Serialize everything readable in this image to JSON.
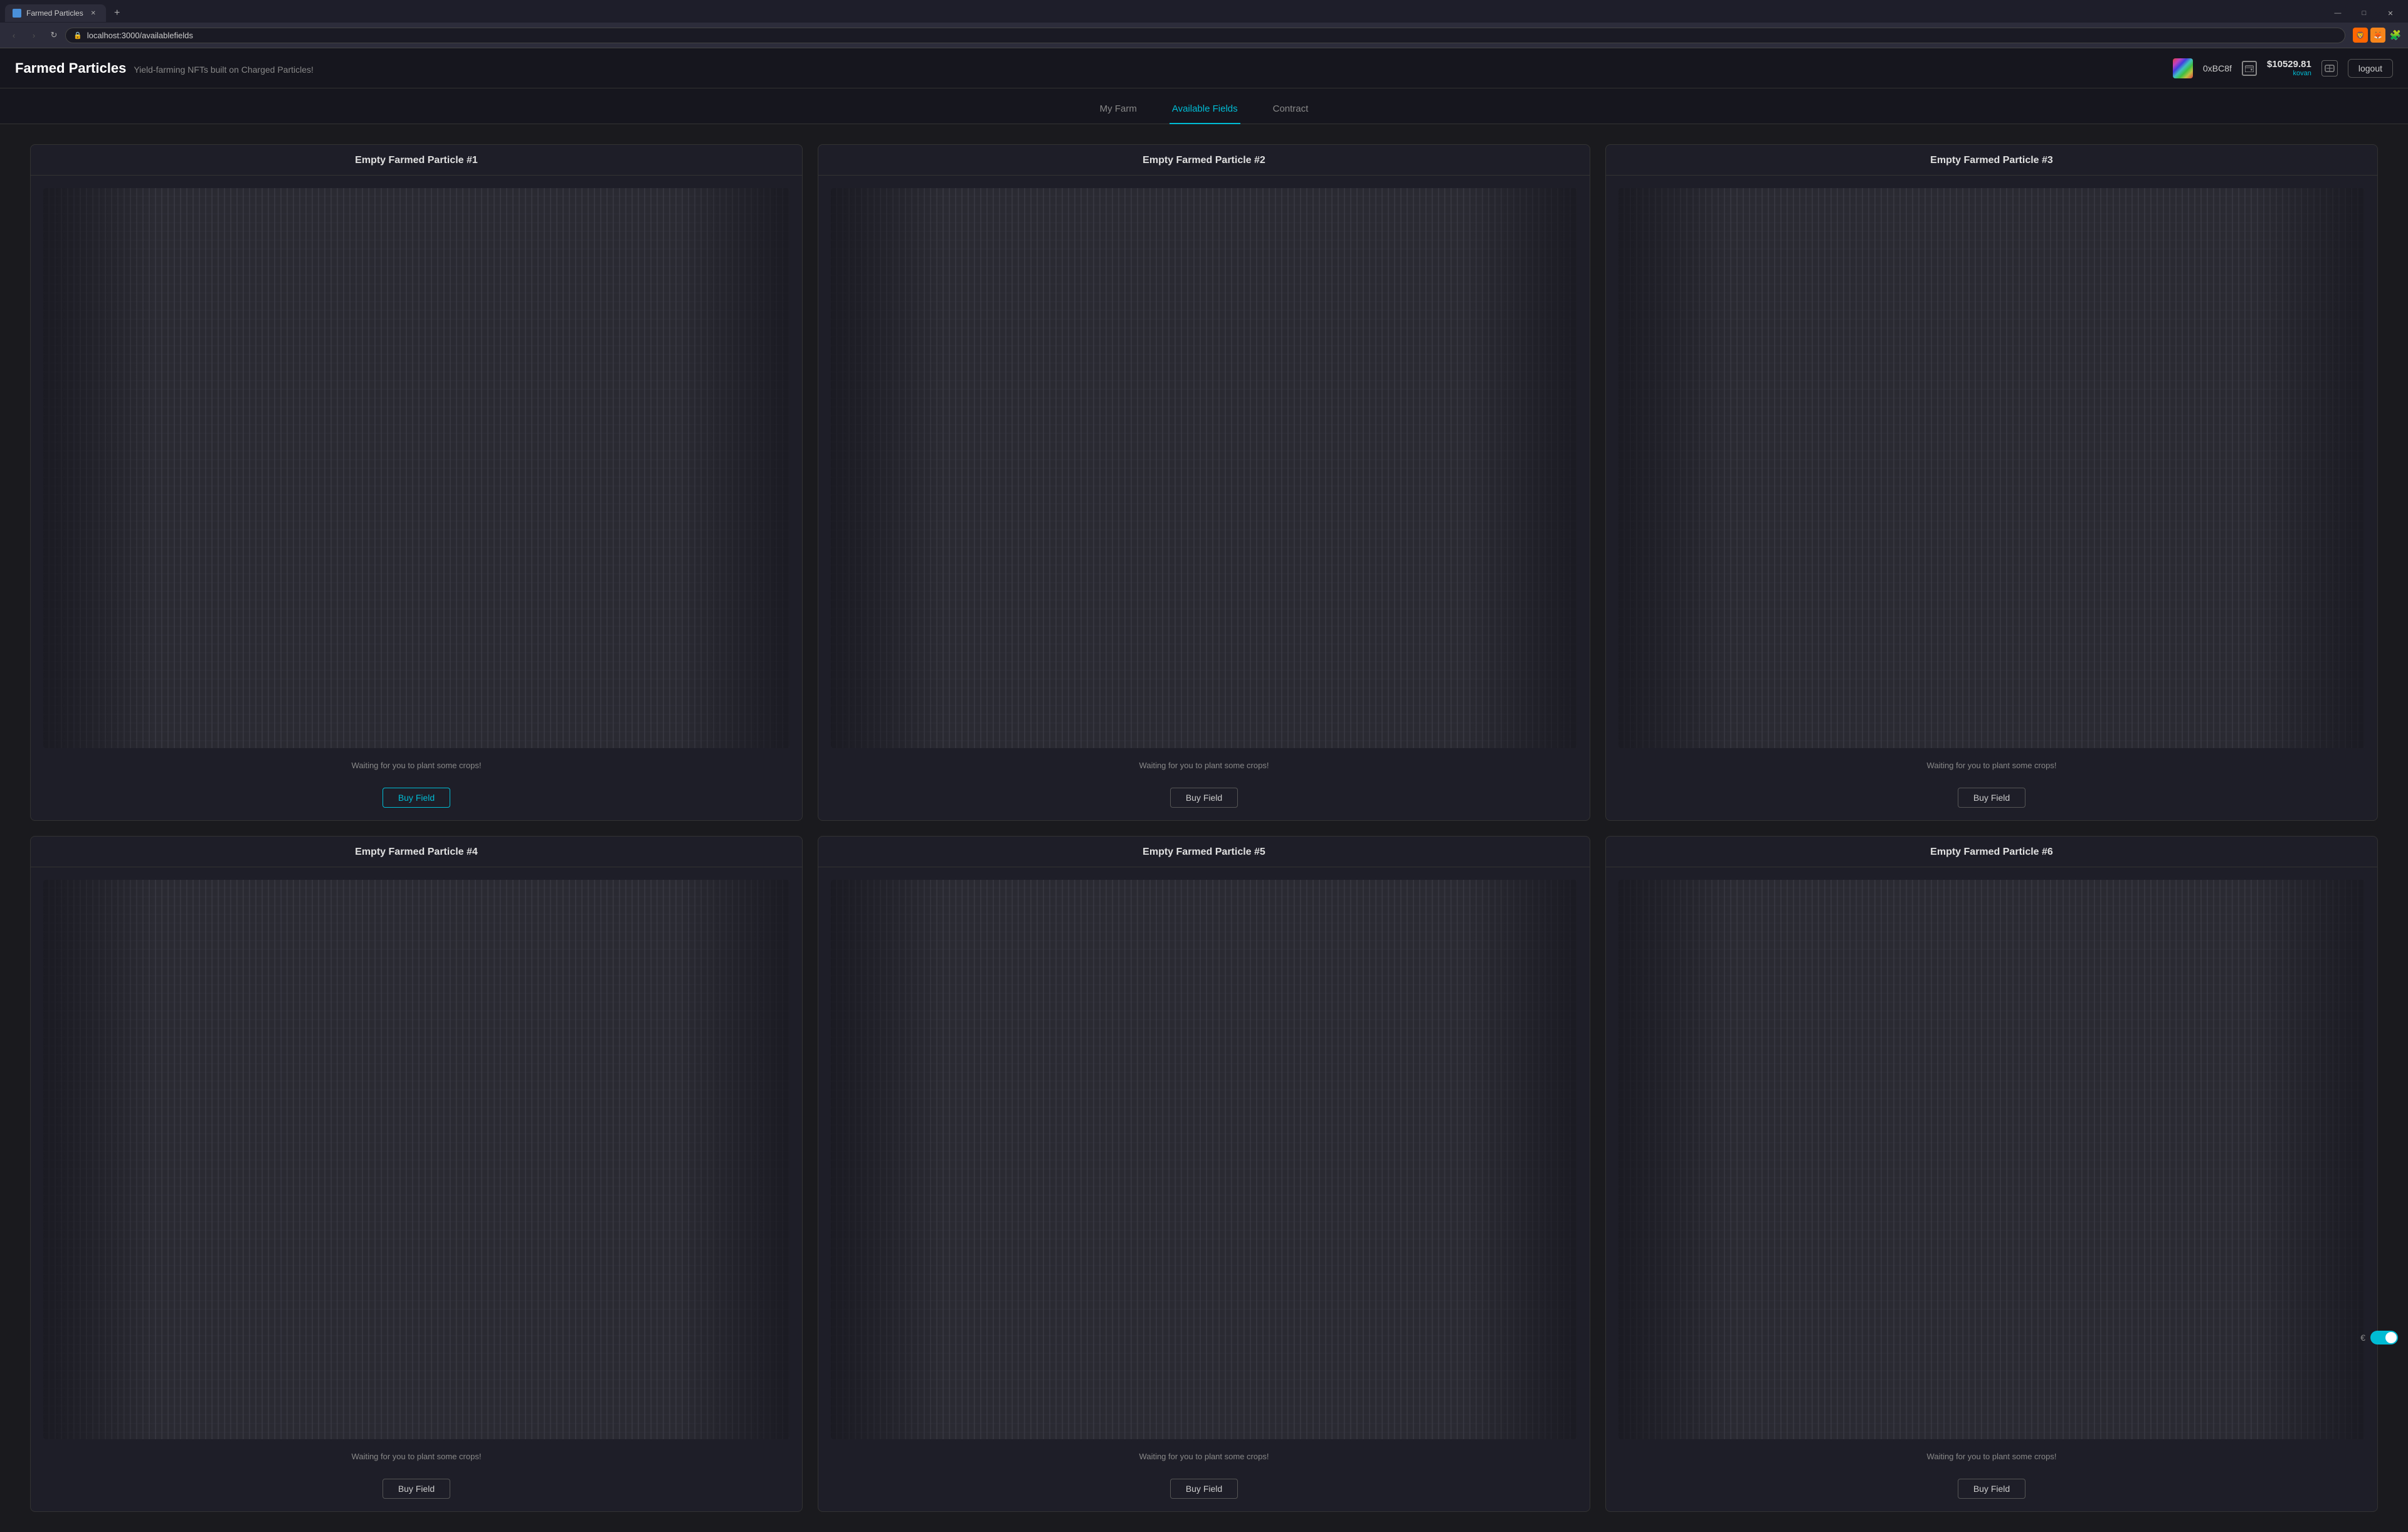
{
  "browser": {
    "tab_title": "Farmed Particles",
    "tab_favicon": "🌱",
    "new_tab_label": "+",
    "address_bar": "localhost:3000/availablefields",
    "minimize_label": "—",
    "maximize_label": "□",
    "close_label": "✕",
    "back_label": "‹",
    "forward_label": "›",
    "refresh_label": "↻",
    "bookmark_label": "⭐"
  },
  "header": {
    "app_title": "Farmed Particles",
    "app_subtitle": "Yield-farming NFTs built on Charged Particles!",
    "wallet_address": "0xBC8f",
    "wallet_balance": "$10529.81",
    "network_label": "kovan",
    "logout_label": "logout"
  },
  "nav": {
    "tabs": [
      {
        "id": "my-farm",
        "label": "My Farm",
        "active": false
      },
      {
        "id": "available-fields",
        "label": "Available Fields",
        "active": true
      },
      {
        "id": "contract",
        "label": "Contract",
        "active": false
      }
    ]
  },
  "cards": [
    {
      "id": 1,
      "title": "Empty Farmed Particle #1",
      "status": "Waiting for you to plant some crops!",
      "button_label": "Buy Field",
      "highlighted": true
    },
    {
      "id": 2,
      "title": "Empty Farmed Particle #2",
      "status": "Waiting for you to plant some crops!",
      "button_label": "Buy Field",
      "highlighted": false
    },
    {
      "id": 3,
      "title": "Empty Farmed Particle #3",
      "status": "Waiting for you to plant some crops!",
      "button_label": "Buy Field",
      "highlighted": false
    },
    {
      "id": 4,
      "title": "Empty Farmed Particle #4",
      "status": "Waiting for you to plant some crops!",
      "button_label": "Buy Field",
      "highlighted": false
    },
    {
      "id": 5,
      "title": "Empty Farmed Particle #5",
      "status": "Waiting for you to plant some crops!",
      "button_label": "Buy Field",
      "highlighted": false
    },
    {
      "id": 6,
      "title": "Empty Farmed Particle #6",
      "status": "Waiting for you to plant some crops!",
      "button_label": "Buy Field",
      "highlighted": false
    }
  ],
  "bottom_toggle": {
    "currency_symbol": "€",
    "toggle_state": "on"
  }
}
